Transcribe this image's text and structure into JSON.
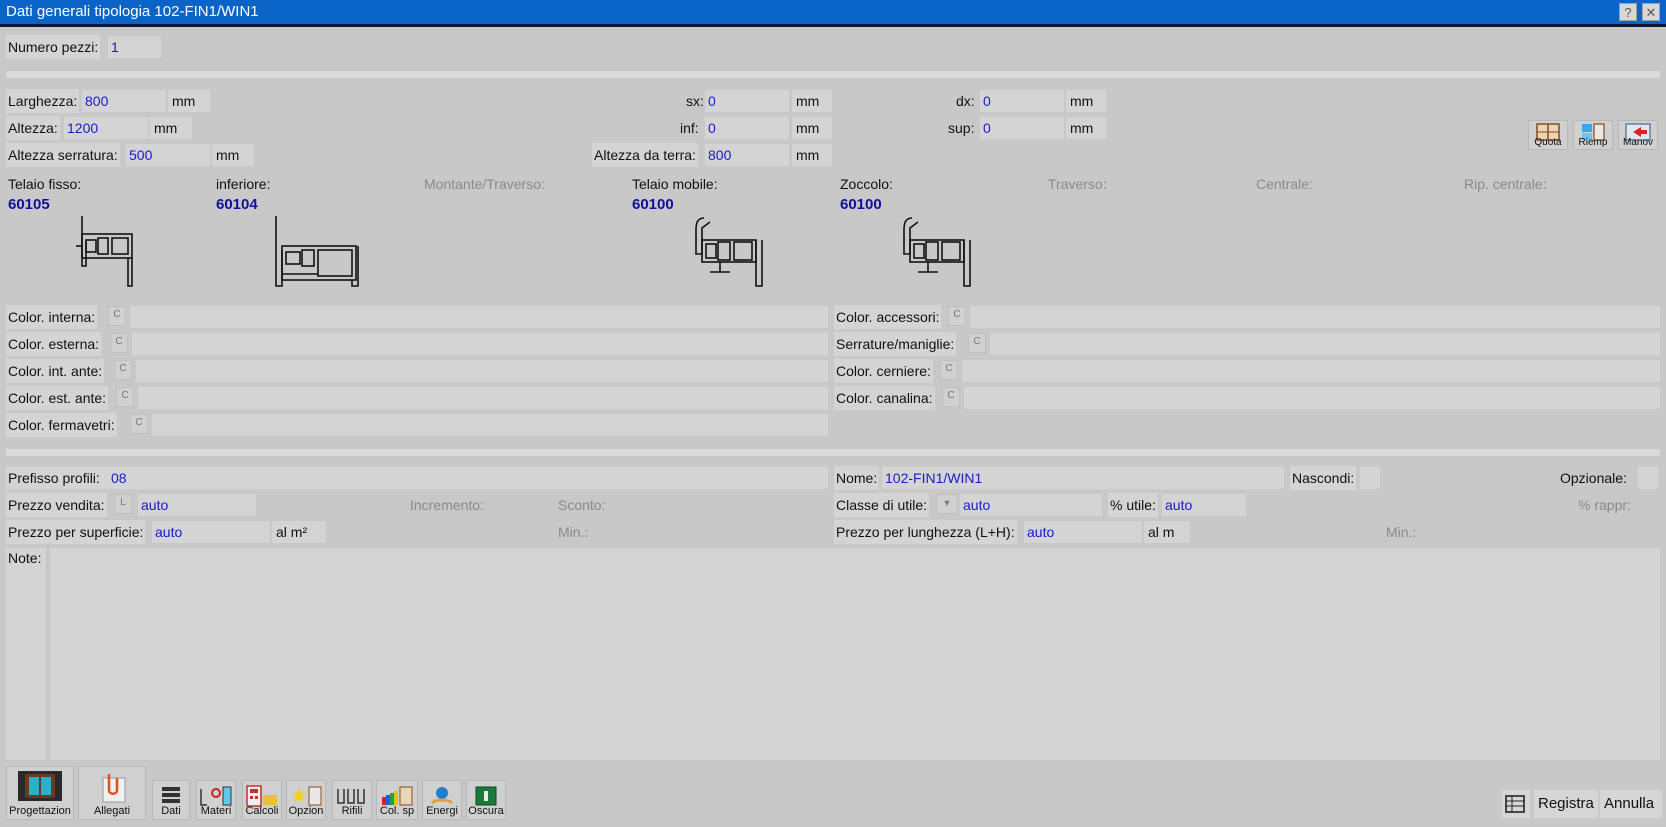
{
  "window": {
    "title": "Dati generali tipologia 102-FIN1/WIN1",
    "help_label": "?",
    "close_label": "✕"
  },
  "numero_pezzi": {
    "label": "Numero pezzi:",
    "value": "1"
  },
  "dims": {
    "larghezza": {
      "label": "Larghezza:",
      "value": "800",
      "unit": "mm"
    },
    "altezza": {
      "label": "Altezza:",
      "value": "1200",
      "unit": "mm"
    },
    "altezza_serratura": {
      "label": "Altezza serratura:",
      "value": "500",
      "unit": "mm"
    },
    "sx": {
      "label": "sx:",
      "value": "0",
      "unit": "mm"
    },
    "inf": {
      "label": "inf:",
      "value": "0",
      "unit": "mm"
    },
    "altezza_terra": {
      "label": "Altezza da terra:",
      "value": "800",
      "unit": "mm"
    },
    "dx": {
      "label": "dx:",
      "value": "0",
      "unit": "mm"
    },
    "sup": {
      "label": "sup:",
      "value": "0",
      "unit": "mm"
    }
  },
  "side_tools": [
    {
      "label": "Quota",
      "icon": "window-quota-icon"
    },
    {
      "label": "Riemp",
      "icon": "fill-icon"
    },
    {
      "label": "Manov",
      "icon": "maneuver-icon"
    }
  ],
  "profiles": [
    {
      "label": "Telaio fisso:",
      "code": "60105",
      "enabled": true
    },
    {
      "label": "inferiore:",
      "code": "60104",
      "enabled": true
    },
    {
      "label": "Montante/Traverso:",
      "code": "",
      "enabled": false
    },
    {
      "label": "Telaio mobile:",
      "code": "60100",
      "enabled": true
    },
    {
      "label": "Zoccolo:",
      "code": "60100",
      "enabled": true
    },
    {
      "label": "Traverso:",
      "code": "",
      "enabled": false
    },
    {
      "label": "Centrale:",
      "code": "",
      "enabled": false
    },
    {
      "label": "Rip. centrale:",
      "code": "",
      "enabled": false
    }
  ],
  "colors_left": [
    {
      "label": "Color. interna:",
      "btn": "C",
      "value": ""
    },
    {
      "label": "Color. esterna:",
      "btn": "C",
      "value": ""
    },
    {
      "label": "Color. int. ante:",
      "btn": "C",
      "value": ""
    },
    {
      "label": "Color. est. ante:",
      "btn": "C",
      "value": ""
    },
    {
      "label": "Color. fermavetri:",
      "btn": "C",
      "value": ""
    }
  ],
  "colors_right": [
    {
      "label": "Color. accessori:",
      "btn": "C",
      "value": ""
    },
    {
      "label": "Serrature/maniglie:",
      "btn": "C",
      "value": ""
    },
    {
      "label": "Color. cerniere:",
      "btn": "C",
      "value": ""
    },
    {
      "label": "Color. canalina:",
      "btn": "C",
      "value": ""
    }
  ],
  "pricing": {
    "prefisso": {
      "label": "Prefisso profili:",
      "value": "08"
    },
    "nome": {
      "label": "Nome:",
      "value": "102-FIN1/WIN1"
    },
    "nascondi": {
      "label": "Nascondi:"
    },
    "opzionale": {
      "label": "Opzionale:"
    },
    "prezzo_vendita": {
      "label": "Prezzo vendita:",
      "btn": "L",
      "value": "auto"
    },
    "incremento": {
      "label": "Incremento:"
    },
    "sconto": {
      "label": "Sconto:"
    },
    "classe_utile": {
      "label": "Classe di utile:",
      "value": "auto"
    },
    "perc_utile": {
      "label": "% utile:",
      "value": "auto"
    },
    "perc_rappr": {
      "label": "% rappr:"
    },
    "prezzo_superficie": {
      "label": "Prezzo per superficie:",
      "value": "auto",
      "unit": "al m²"
    },
    "min1": {
      "label": "Min.:"
    },
    "prezzo_lunghezza": {
      "label": "Prezzo per lunghezza (L+H):",
      "value": "auto",
      "unit": "al m"
    },
    "min2": {
      "label": "Min.:"
    },
    "note": {
      "label": "Note:",
      "value": ""
    }
  },
  "toolbar": [
    {
      "label": "Progettazion",
      "icon": "design-icon"
    },
    {
      "label": "Allegati",
      "icon": "paperclip-icon"
    },
    {
      "label": "Dati",
      "icon": "list-icon"
    },
    {
      "label": "Materi",
      "icon": "materials-icon"
    },
    {
      "label": "Calcoli",
      "icon": "calculator-icon"
    },
    {
      "label": "Opzion",
      "icon": "options-icon"
    },
    {
      "label": "Rifili",
      "icon": "trim-icon"
    },
    {
      "label": "Col. sp",
      "icon": "color-icon"
    },
    {
      "label": "Energi",
      "icon": "energy-icon"
    },
    {
      "label": "Oscura",
      "icon": "shutter-icon"
    }
  ],
  "actions": {
    "registra": "Registra",
    "annulla": "Annulla"
  }
}
